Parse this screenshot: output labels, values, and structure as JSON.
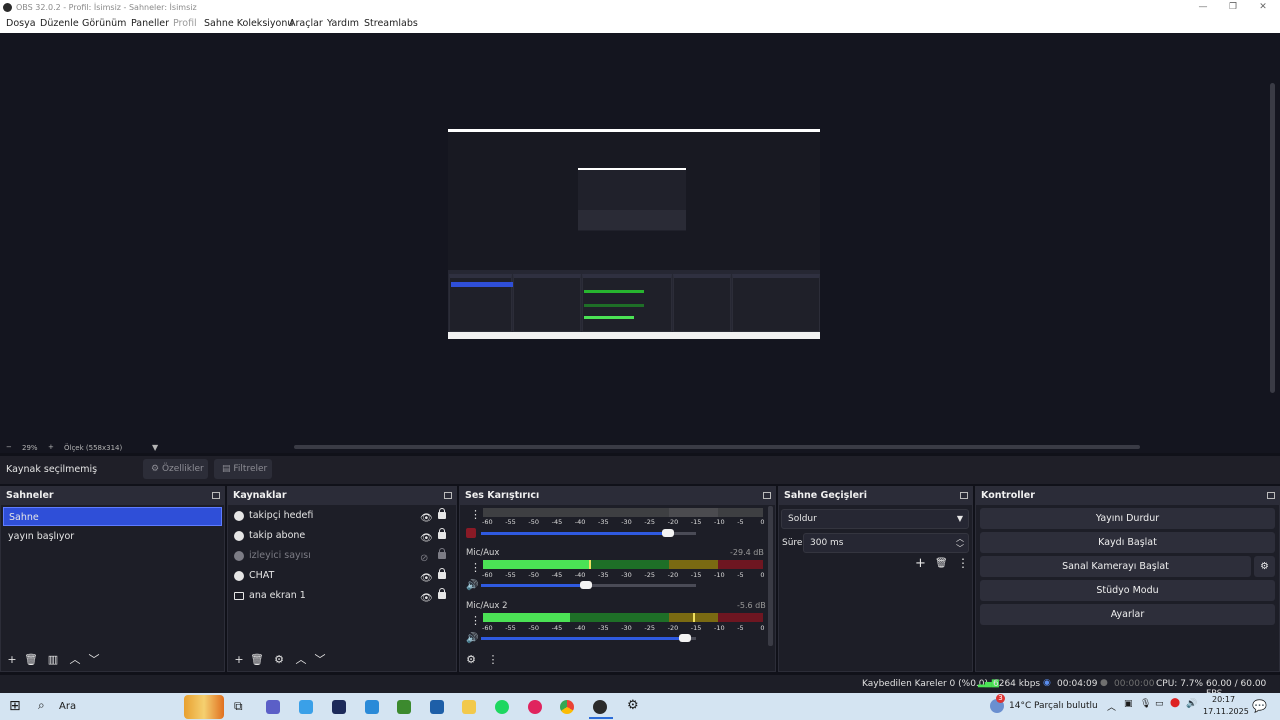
{
  "window": {
    "title": "OBS 32.0.2 - Profil: İsimsiz - Sahneler: İsimsiz"
  },
  "menu": {
    "items": [
      "Dosya",
      "Düzenle",
      "Görünüm",
      "Paneller",
      "Profil",
      "Sahne Koleksiyonu",
      "Araçlar",
      "Yardım",
      "Streamlabs"
    ]
  },
  "preview": {
    "zoom": "29%",
    "scale_mode": "Ölçek (558x314)"
  },
  "context": {
    "no_source": "Kaynak seçilmemiş",
    "properties": "Özellikler",
    "filters": "Filtreler"
  },
  "scenes": {
    "title": "Sahneler",
    "items": [
      "Sahne",
      "yayın başlıyor"
    ]
  },
  "sources": {
    "title": "Kaynaklar",
    "items": [
      "takipçi hedefi",
      "takip abone",
      "izleyici sayısı",
      "CHAT",
      "ana ekran 1"
    ]
  },
  "mixer": {
    "title": "Ses Karıştırıcı",
    "scale": [
      "-60",
      "-55",
      "-50",
      "-45",
      "-40",
      "-35",
      "-30",
      "-25",
      "-20",
      "-15",
      "-10",
      "-5",
      "0"
    ],
    "channels": [
      {
        "name": "",
        "db": "",
        "level": 0.0,
        "volume": 0.87
      },
      {
        "name": "Mic/Aux",
        "db": "-29.4 dB",
        "level": 0.38,
        "volume": 0.49
      },
      {
        "name": "Mic/Aux 2",
        "db": "-5.6 dB",
        "level": 0.31,
        "volume": 0.95
      }
    ]
  },
  "transitions": {
    "title": "Sahne Geçişleri",
    "selected": "Soldur",
    "duration_label": "Süre",
    "duration": "300 ms"
  },
  "controls": {
    "title": "Kontroller",
    "stop_stream": "Yayını Durdur",
    "start_record": "Kaydı Başlat",
    "virtual_cam": "Sanal Kamerayı Başlat",
    "studio_mode": "Stüdyo Modu",
    "settings": "Ayarlar"
  },
  "status": {
    "dropped": "Kaybedilen Kareler 0 (%0.0)",
    "bitrate": "6264 kbps",
    "stream_time": "00:04:09",
    "rec_time": "00:00:00",
    "cpu": "CPU: 7.7%",
    "fps": "60.00 / 60.00 FPS"
  },
  "taskbar": {
    "search": "Ara",
    "weather_temp": "14°C",
    "weather_text": "Parçalı bulutlu",
    "time": "20:17",
    "date": "17.11.2025",
    "badge": "3"
  }
}
